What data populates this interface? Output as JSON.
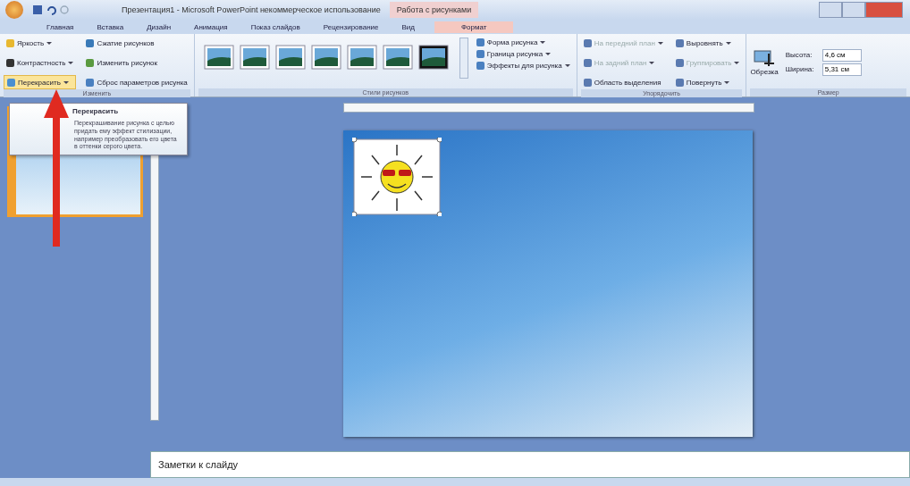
{
  "window": {
    "title": "Презентация1 - Microsoft PowerPoint некоммерческое использование",
    "context_tab": "Работа с рисунками"
  },
  "tabs": [
    {
      "label": "Главная",
      "selected": false
    },
    {
      "label": "Вставка",
      "selected": false
    },
    {
      "label": "Дизайн",
      "selected": false
    },
    {
      "label": "Анимация",
      "selected": false
    },
    {
      "label": "Показ слайдов",
      "selected": false
    },
    {
      "label": "Рецензирование",
      "selected": false
    },
    {
      "label": "Вид",
      "selected": false
    },
    {
      "label": "Формат",
      "selected": true
    }
  ],
  "ribbon": {
    "adjust": {
      "label": "Изменить",
      "buttons": [
        {
          "label": "Яркость",
          "dropdown": true,
          "highlighted": false
        },
        {
          "label": "Контрастность",
          "dropdown": true,
          "highlighted": false
        },
        {
          "label": "Перекрасить",
          "dropdown": true,
          "highlighted": true
        },
        {
          "label": "Сжатие рисунков",
          "dropdown": false,
          "highlighted": false
        },
        {
          "label": "Изменить рисунок",
          "dropdown": false,
          "highlighted": false
        },
        {
          "label": "Сброс параметров рисунка",
          "dropdown": false,
          "highlighted": false
        }
      ]
    },
    "styles": {
      "label": "Стили рисунков",
      "gallery": [
        {
          "selected": false
        },
        {
          "selected": false
        },
        {
          "selected": false
        },
        {
          "selected": false
        },
        {
          "selected": false
        },
        {
          "selected": false
        },
        {
          "selected": true
        }
      ],
      "buttons": [
        {
          "label": "Форма рисунка",
          "dropdown": true
        },
        {
          "label": "Граница рисунка",
          "dropdown": true
        },
        {
          "label": "Эффекты для рисунка",
          "dropdown": true
        }
      ]
    },
    "arrange": {
      "label": "Упорядочить",
      "buttons": [
        {
          "label": "На передний план",
          "dropdown": true,
          "disabled": true
        },
        {
          "label": "На задний план",
          "dropdown": true,
          "disabled": true
        },
        {
          "label": "Область выделения",
          "dropdown": false,
          "disabled": false
        },
        {
          "label": "Выровнять",
          "dropdown": true,
          "disabled": false
        },
        {
          "label": "Группировать",
          "dropdown": true,
          "disabled": true
        },
        {
          "label": "Повернуть",
          "dropdown": true,
          "disabled": false
        }
      ]
    },
    "size": {
      "label": "Размер",
      "crop": "Обрезка",
      "fields": [
        {
          "label": "Высота:",
          "value": "4,6 см"
        },
        {
          "label": "Ширина:",
          "value": "5,31 см"
        }
      ]
    }
  },
  "tooltip": {
    "title": "Перекрасить",
    "text": "Перекрашивание рисунка с целью придать ему эффект стилизации, например преобразовать его цвета в оттенки серого цвета."
  },
  "notes": {
    "placeholder": "Заметки к слайду"
  }
}
